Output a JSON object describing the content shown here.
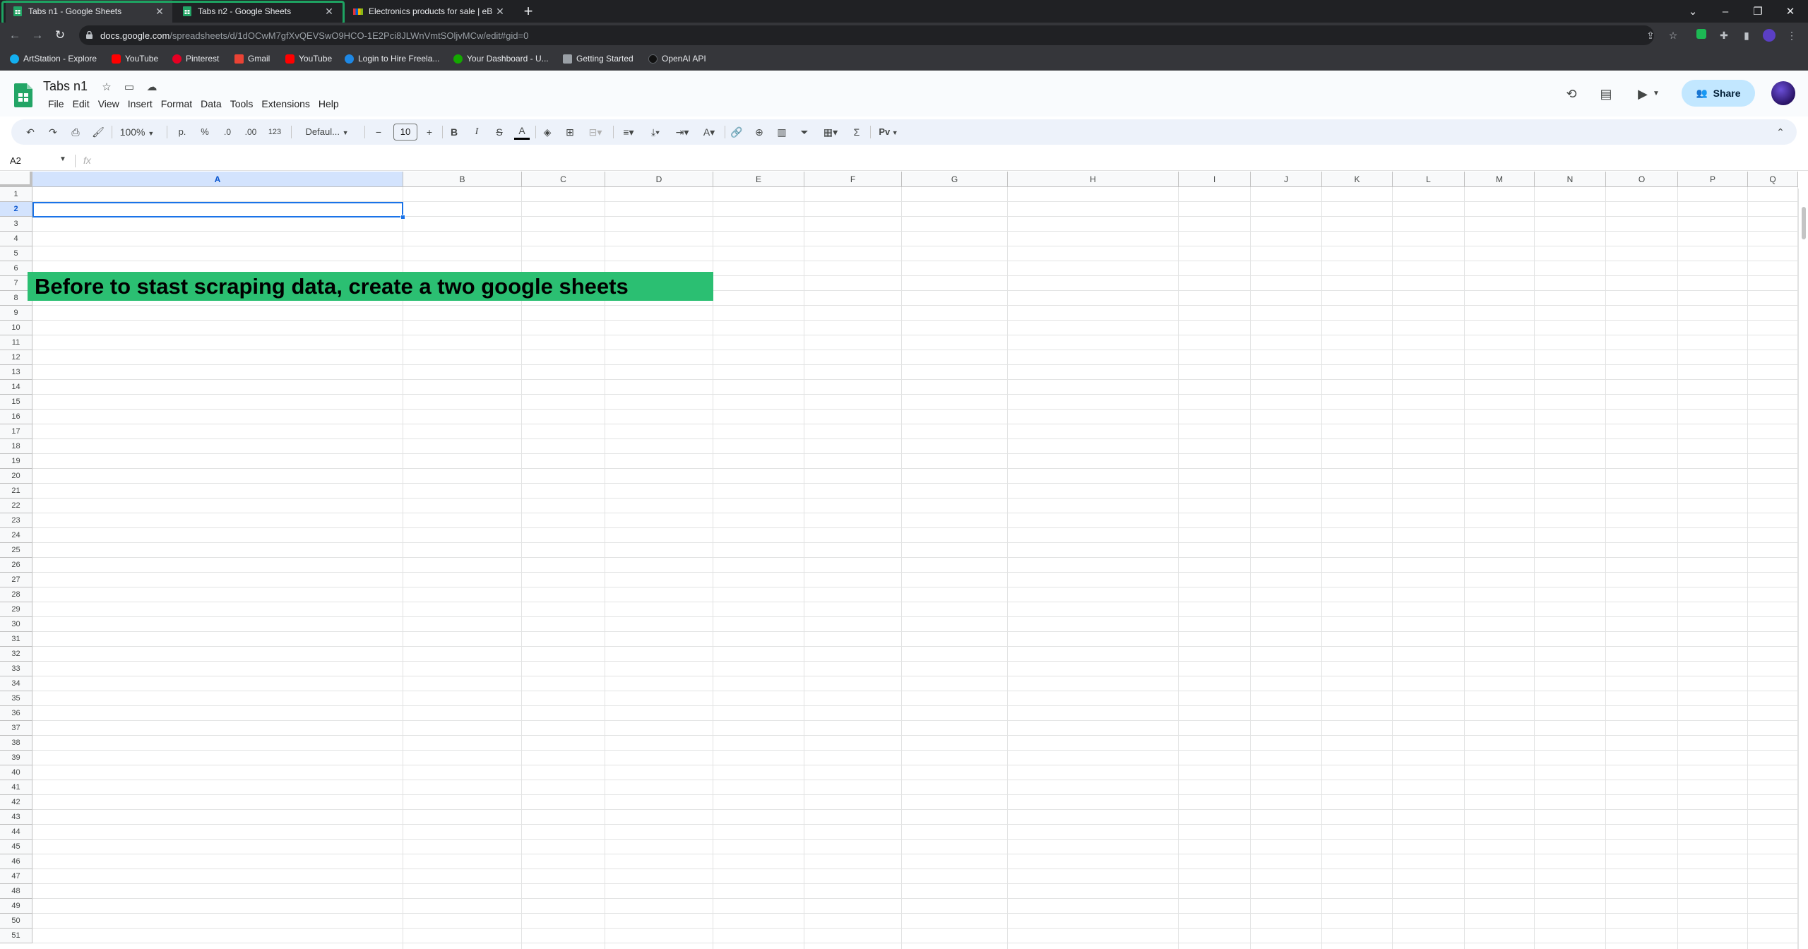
{
  "browser": {
    "tabs": [
      {
        "title": "Tabs n1 - Google Sheets",
        "active": true
      },
      {
        "title": "Tabs n2 - Google Sheets",
        "active": false
      },
      {
        "title": "Electronics products for sale | eB",
        "active": false
      }
    ],
    "new_tab_symbol": "+",
    "tab_close_symbol": "✕",
    "url_host": "docs.google.com",
    "url_path": "/spreadsheets/d/1dOCwM7gfXvQEVSwO9HCO-1E2Pci8JLWnVmtSOljvMCw/edit#gid=0",
    "bookmarks": [
      {
        "label": "ArtStation - Explore",
        "color": "#13aff0"
      },
      {
        "label": "YouTube",
        "color": "#ff0000"
      },
      {
        "label": "Pinterest",
        "color": "#e60023"
      },
      {
        "label": "Gmail",
        "color": "#ea4335"
      },
      {
        "label": "YouTube",
        "color": "#ff0000"
      },
      {
        "label": "Login to Hire Freela...",
        "color": "#1e88e5"
      },
      {
        "label": "Your Dashboard - U...",
        "color": "#14a800"
      },
      {
        "label": "Getting Started",
        "color": "#9aa0a6"
      },
      {
        "label": "OpenAI API",
        "color": "#202124"
      }
    ]
  },
  "sheets": {
    "title": "Tabs n1",
    "menu": [
      "File",
      "Edit",
      "View",
      "Insert",
      "Format",
      "Data",
      "Tools",
      "Extensions",
      "Help"
    ],
    "share_label": "Share",
    "toolbar": {
      "zoom": "100%",
      "currency": "р.",
      "percent": "%",
      "dec_decrease": ".0",
      "dec_increase": ".00",
      "number_format": "123",
      "font": "Defaul...",
      "font_size": "10",
      "bold": "B",
      "italic": "I",
      "strike": "S",
      "text_color": "A",
      "sum": "Σ",
      "plugin": "Pv"
    },
    "name_box": "A2",
    "fx_label": "fx",
    "columns": [
      "A",
      "B",
      "C",
      "D",
      "E",
      "F",
      "G",
      "H",
      "I",
      "J",
      "K",
      "L",
      "M",
      "N",
      "O",
      "P",
      "Q"
    ],
    "selected_column": "A",
    "selected_row": "2",
    "row_count": 51,
    "banner_text": "Before to stast scraping data, create a two google sheets",
    "banner_color": "#2bbf72",
    "accent_color": "#1a73e8"
  }
}
